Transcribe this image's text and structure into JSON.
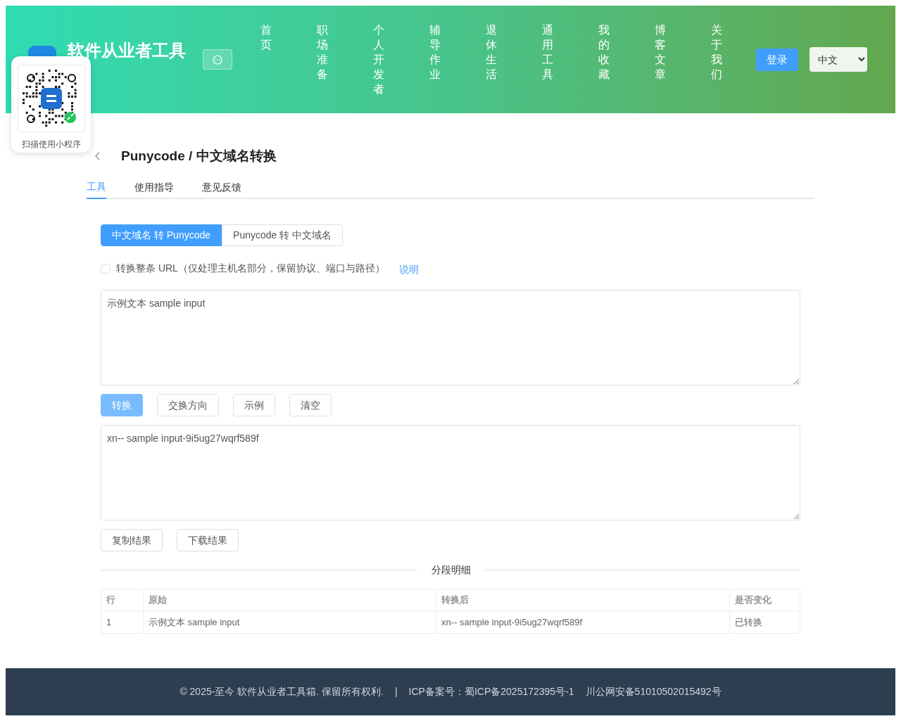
{
  "header": {
    "site_title": "软件从业者工具",
    "nav": [
      "首页",
      "职场准备",
      "个人开发者",
      "辅导作业",
      "退休生活",
      "通用工具",
      "我的收藏",
      "博客文章",
      "关于我们"
    ],
    "login_button": "登录",
    "language": "中文"
  },
  "qr_popup": {
    "caption": "扫描使用小程序"
  },
  "page": {
    "title": "Punycode / 中文域名转换",
    "tabs": [
      {
        "label": "工具",
        "selected": true
      },
      {
        "label": "使用指导",
        "selected": false
      },
      {
        "label": "意见反馈",
        "selected": false
      }
    ],
    "modes": [
      {
        "label": "中文域名 转 Punycode",
        "selected": true
      },
      {
        "label": "Punycode 转 中文域名",
        "selected": false
      }
    ],
    "url_option": {
      "label": "转换整条 URL（仅处理主机名部分，保留协议、端口与路径）",
      "checked": false,
      "link": "说明"
    },
    "input": {
      "value": "示例文本 sample input"
    },
    "actions": [
      {
        "label": "转换",
        "kind": "primary"
      },
      {
        "label": "交换方向",
        "kind": "default"
      },
      {
        "label": "示例",
        "kind": "default"
      },
      {
        "label": "清空",
        "kind": "default"
      }
    ],
    "output": {
      "value": "xn-- sample input-9i5ug27wqrf589f"
    },
    "result_actions": [
      "复制结果",
      "下载结果"
    ],
    "section_title": "分段明细",
    "table": {
      "columns": [
        "行",
        "原始",
        "转换后",
        "是否变化"
      ],
      "rows": [
        [
          "1",
          "示例文本 sample input",
          "xn-- sample input-9i5ug27wqrf589f",
          "已转换"
        ]
      ]
    }
  },
  "footer": {
    "copyright": "© 2025-至今 软件从业者工具箱. 保留所有权利.",
    "separator": "|",
    "icp": "ICP备案号：蜀ICP备2025172395号-1",
    "police": "川公网安备51010502015492号"
  }
}
